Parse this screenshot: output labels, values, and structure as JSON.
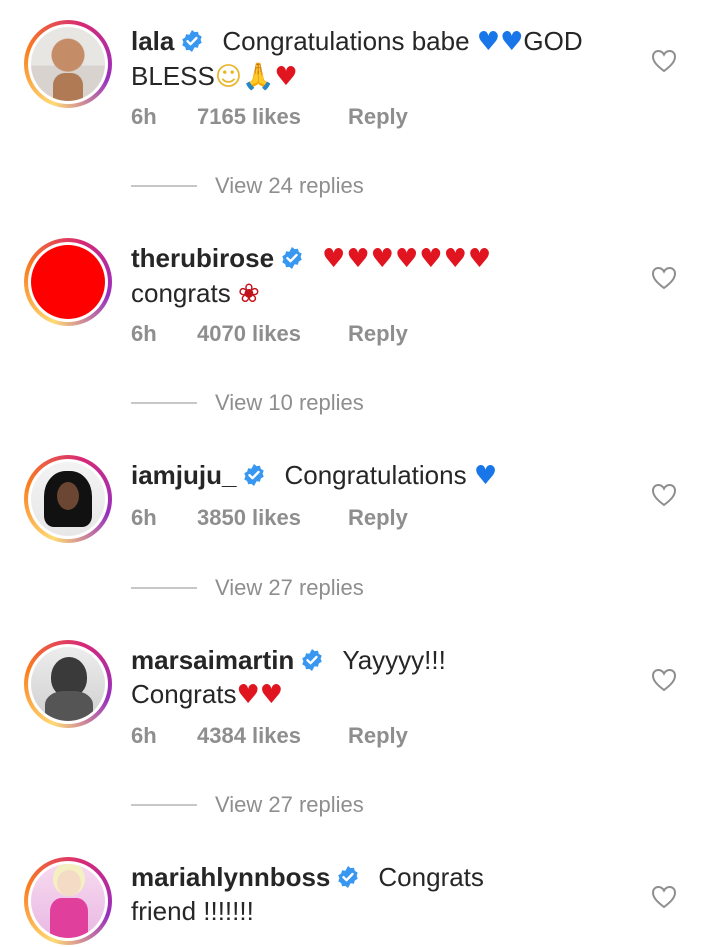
{
  "comments": [
    {
      "username": "lala",
      "text": "Congratulations babe",
      "text_after_emoji": "GOD BLESS",
      "time": "6h",
      "likes": "7165 likes",
      "reply": "Reply",
      "replies": "View 24 replies"
    },
    {
      "username": "therubirose",
      "text": "congrats",
      "time": "6h",
      "likes": "4070 likes",
      "reply": "Reply",
      "replies": "View 10 replies"
    },
    {
      "username": "iamjuju_",
      "text": "Congratulations",
      "time": "6h",
      "likes": "3850 likes",
      "reply": "Reply",
      "replies": "View 27 replies"
    },
    {
      "username": "marsaimartin",
      "text": "Yayyyy!!!",
      "text_line2": "Congrats",
      "time": "6h",
      "likes": "4384 likes",
      "reply": "Reply",
      "replies": "View 27 replies"
    },
    {
      "username": "mariahlynnboss",
      "text": "Congrats",
      "text_line2": "friend !!!!!!!"
    }
  ],
  "icons": {
    "verified_badge": "verified-badge-icon",
    "like": "heart-outline-icon"
  },
  "colors": {
    "verified": "#3897f0",
    "meta_text": "#8e8e8e",
    "red_heart": "#e0151f",
    "blue_heart": "#1976e8"
  }
}
